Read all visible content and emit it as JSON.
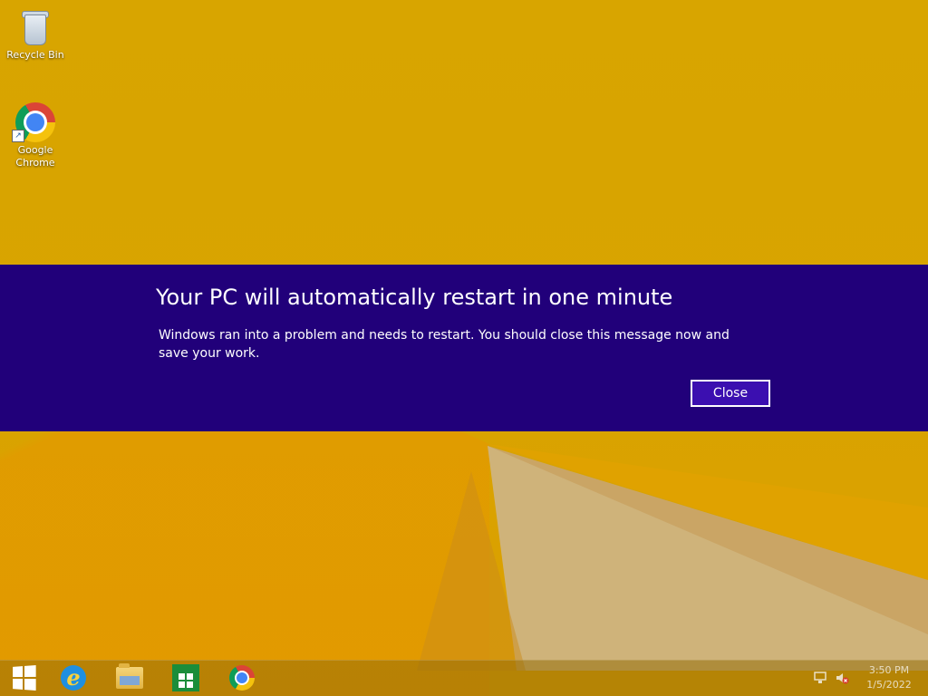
{
  "desktop": {
    "icons": [
      {
        "label": "Recycle Bin",
        "icon": "recycle-bin-icon"
      },
      {
        "label": "Google\nChrome",
        "icon": "chrome-icon"
      }
    ]
  },
  "dialog": {
    "title": "Your PC will automatically restart in one minute",
    "message": "Windows ran into a problem and needs to restart. You should close this message now and save your work.",
    "close_label": "Close",
    "background_color": "#21007a"
  },
  "taskbar": {
    "items": [
      {
        "icon": "windows-start-icon"
      },
      {
        "icon": "internet-explorer-icon"
      },
      {
        "icon": "file-explorer-icon"
      },
      {
        "icon": "windows-store-icon"
      },
      {
        "icon": "chrome-icon"
      }
    ],
    "tray": [
      {
        "icon": "network-icon"
      },
      {
        "icon": "volume-muted-icon"
      }
    ],
    "clock": {
      "time": "3:50 PM",
      "date": "1/5/2022"
    }
  }
}
